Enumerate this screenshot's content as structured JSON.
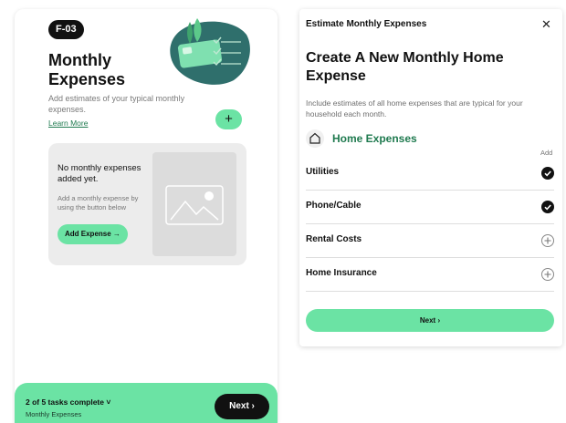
{
  "left": {
    "badge": "F-03",
    "title": "Monthly Expenses",
    "description": "Add estimates of your typical monthly expenses.",
    "learn_more": "Learn More",
    "add_fab": "+",
    "empty_state": {
      "title": "No monthly expenses added yet.",
      "description": "Add a monthly expense by using the button below",
      "add_button": "Add Expense →"
    },
    "bottom_bar": {
      "task_count": "2 of 5 tasks complete ˅",
      "subtitle": "Monthly Expenses",
      "next": "Next ›"
    }
  },
  "modal": {
    "header_title": "Estimate Monthly Expenses",
    "close": "✕",
    "title": "Create A New Monthly Home Expense",
    "description": "Include estimates of all home expenses that are typical for your household each month.",
    "section_title": "Home Expenses",
    "add_column_label": "Add",
    "rows": [
      {
        "label": "Utilities",
        "checked": true
      },
      {
        "label": "Phone/Cable",
        "checked": true
      },
      {
        "label": "Rental Costs",
        "checked": false
      },
      {
        "label": "Home Insurance",
        "checked": false
      }
    ],
    "next": "Next ›"
  },
  "colors": {
    "accent_green": "#6be3a4",
    "dark": "#111111",
    "link_green": "#1f7a4f",
    "illustration_teal": "#2f6f6c"
  },
  "icons": {
    "close": "close-icon",
    "home": "home-icon",
    "check": "check-icon",
    "add": "plus-circle-icon",
    "image": "image-placeholder-icon"
  }
}
